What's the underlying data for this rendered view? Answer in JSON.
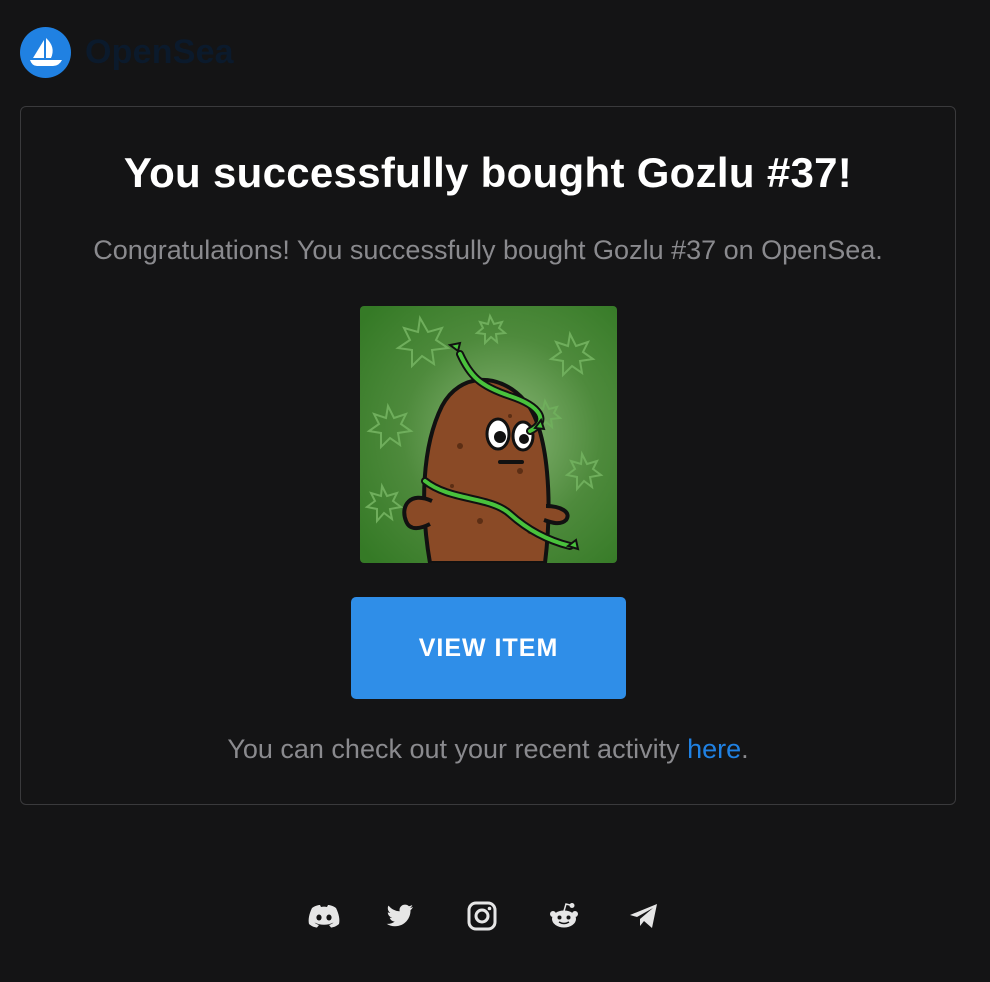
{
  "header": {
    "logo_text": "OpenSea",
    "logo_icon": "opensea-ship-icon",
    "brand_color": "#2081e2"
  },
  "card": {
    "title": "You successfully bought Gozlu #37!",
    "message": "Congratulations! You successfully bought Gozlu #37 on OpenSea.",
    "image_icon": "nft-potato-character-image",
    "button_label": "VIEW ITEM",
    "button_color": "#2f8ee8",
    "activity_prefix": "You can check out your recent activity ",
    "activity_link": "here",
    "activity_suffix": "."
  },
  "footer": {
    "social_icons": [
      "discord-icon",
      "twitter-icon",
      "instagram-icon",
      "reddit-icon",
      "telegram-icon"
    ]
  }
}
